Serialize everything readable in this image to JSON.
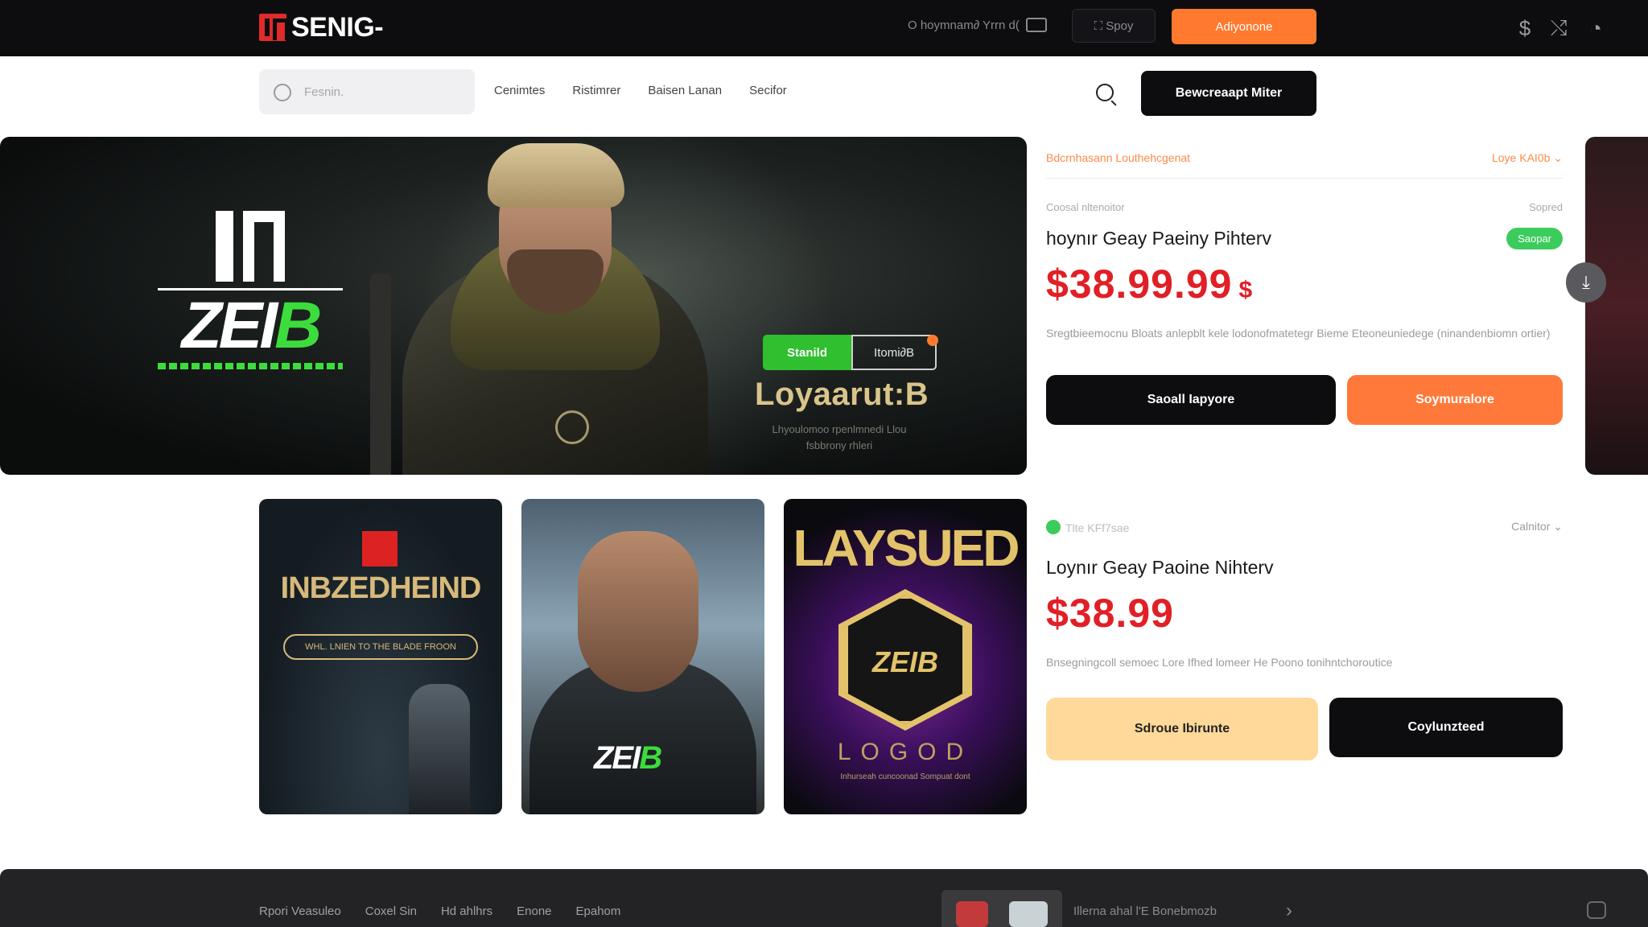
{
  "topbar": {
    "brand": "SENIG-",
    "links": "O hoymnam∂ Yrrn d(",
    "dark_button": "⛶ Spoy",
    "orange_button": "Adiyonone",
    "icons": [
      "dollar-icon",
      "shuffle-icon",
      "gamepad-icon"
    ]
  },
  "subnav": {
    "search_placeholder": "Fesnin.",
    "items": [
      "Cenimtes",
      "Ristimrer",
      "Baisen Lanan",
      "Secifor"
    ],
    "cta": "Bewcreaapt Miter"
  },
  "hero": {
    "logo_word_white": "ZEI",
    "logo_word_green": "B",
    "title": "Loyaarut:B",
    "subtitle": "Lhyoulomoo rpenlmnedi Llou fsbbrony rhleri",
    "btn_primary": "Stanild",
    "btn_secondary": "Itomi∂B"
  },
  "cards": [
    {
      "head_left": "Bdcrnhasann Louthehcgenat",
      "head_right": "Loye KAI0b",
      "meta_left": "Coosal nltenoitor",
      "meta_right": "Sopred",
      "title": "hoynır Geay Paeiny Pihterv",
      "badge": "Saopar",
      "price": "$38.99.99",
      "price_suffix": "$",
      "desc": "Sregtbieemocnu Bloats anlepblt kele lodonofmatetegr Bieme Eteoneuniedege (ninandenbiomn ortier)",
      "btn_left": "Saoall Iapyore",
      "btn_right": "Soymuralore"
    },
    {
      "head_left": "Tlte KFf7sae",
      "head_right": "Calnitor",
      "title": "Loynır Geay Paoine Nihterv",
      "price": "$38.99",
      "desc": "Bnsegningcoll semoec Lore Ifhed lomeer He Poono tonihntchoroutice",
      "btn_left": "Sdroue Ibirunte",
      "btn_right": "Coylunzteed"
    }
  ],
  "thumbs": [
    {
      "title": "INBZEDHEIND",
      "pill": "WHL. LNIEN TO THE BLADE FROON"
    },
    {
      "word_white": "ZEI",
      "word_green": "B"
    },
    {
      "title": "LAYSUED",
      "word": "ZEIB",
      "logo": "LOGOD",
      "sub": "Inhurseah cuncoonad Sompuat dont"
    }
  ],
  "footer": {
    "links": [
      "Rpori Veasuleo",
      "Coxel Sin",
      "Hd ahlhrs",
      "Enone",
      "Epahom"
    ],
    "right": "Illerna ahal   l'E Bonebmozb"
  },
  "colors": {
    "accent_orange": "#ff7a2e",
    "price_red": "#e11f26",
    "accent_green": "#3ccc5c",
    "dark": "#0d0d0f"
  }
}
